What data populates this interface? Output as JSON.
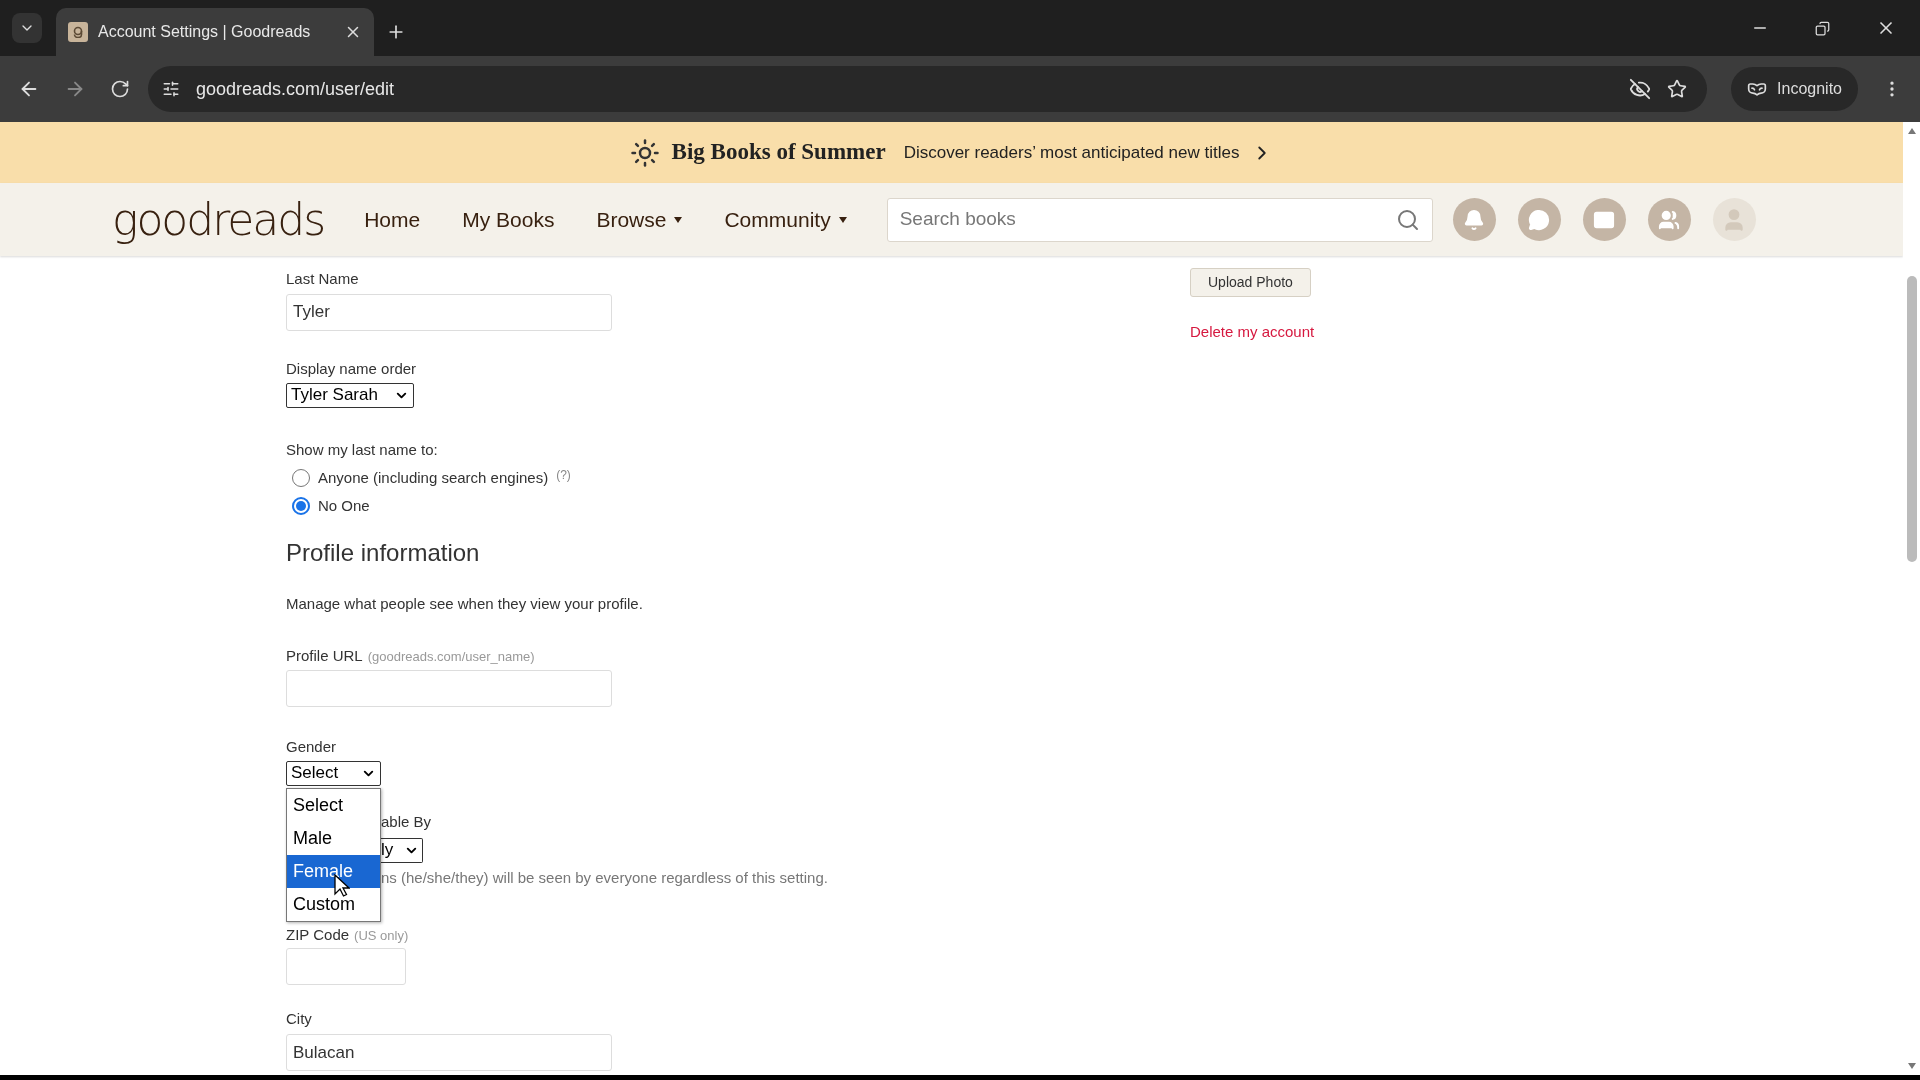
{
  "browser": {
    "tab_title": "Account Settings | Goodreads",
    "url": "goodreads.com/user/edit",
    "incognito_label": "Incognito"
  },
  "banner": {
    "title": "Big Books of Summer",
    "text": "Discover readers’ most anticipated new titles"
  },
  "nav": {
    "logo": "goodreads",
    "items": [
      {
        "label": "Home",
        "dropdown": false
      },
      {
        "label": "My Books",
        "dropdown": false
      },
      {
        "label": "Browse",
        "dropdown": true
      },
      {
        "label": "Community",
        "dropdown": true
      }
    ],
    "search": {
      "placeholder": "Search books"
    }
  },
  "form": {
    "last_name": {
      "label": "Last Name",
      "value": "Tyler"
    },
    "display_name_order": {
      "label": "Display name order",
      "value": "Tyler Sarah"
    },
    "show_last_name": {
      "label": "Show my last name to:",
      "help": "(?)",
      "options": [
        {
          "label": "Anyone (including search engines)",
          "selected": false
        },
        {
          "label": "No One",
          "selected": true
        }
      ]
    },
    "section_title": "Profile information",
    "section_description": "Manage what people see when they view your profile.",
    "profile_url": {
      "label": "Profile URL",
      "hint": "(goodreads.com/user_name)"
    },
    "gender": {
      "label": "Gender",
      "value": "Select",
      "options": [
        {
          "label": "Select",
          "highlighted": false
        },
        {
          "label": "Male",
          "highlighted": false
        },
        {
          "label": "Female",
          "highlighted": true
        },
        {
          "label": "Custom",
          "highlighted": false
        }
      ]
    },
    "viewable_label_fragment": "able By",
    "viewable_value_fragment": "ly",
    "pronoun_note_fragment": "ns (he/she/they) will be seen by everyone regardless of this setting.",
    "zip_code": {
      "label": "ZIP Code",
      "hint": "(US only)"
    },
    "city": {
      "label": "City",
      "value": "Bulacan"
    }
  },
  "sidebar": {
    "upload_button": "Upload Photo",
    "delete_link": "Delete my account"
  }
}
